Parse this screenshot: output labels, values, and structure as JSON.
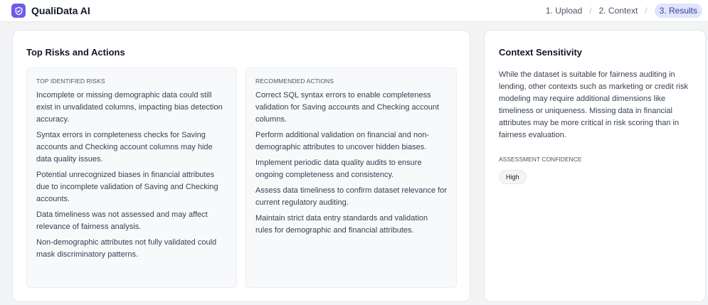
{
  "header": {
    "brand": "QualiData AI",
    "steps": [
      {
        "label": "1. Upload"
      },
      {
        "label": "2. Context"
      },
      {
        "label": "3. Results"
      }
    ],
    "separator": "/"
  },
  "main": {
    "title": "Top Risks and Actions",
    "risks": {
      "label": "TOP IDENTIFIED RISKS",
      "items": [
        "Incomplete or missing demographic data could still exist in unvalidated columns, impacting bias detection accuracy.",
        "Syntax errors in completeness checks for Saving accounts and Checking account columns may hide data quality issues.",
        "Potential unrecognized biases in financial attributes due to incomplete validation of Saving and Checking accounts.",
        "Data timeliness was not assessed and may affect relevance of fairness analysis.",
        "Non-demographic attributes not fully validated could mask discriminatory patterns."
      ]
    },
    "actions": {
      "label": "RECOMMENDED ACTIONS",
      "items": [
        "Correct SQL syntax errors to enable completeness validation for Saving accounts and Checking account columns.",
        "Perform additional validation on financial and non-demographic attributes to uncover hidden biases.",
        "Implement periodic data quality audits to ensure ongoing completeness and consistency.",
        "Assess data timeliness to confirm dataset relevance for current regulatory auditing.",
        "Maintain strict data entry standards and validation rules for demographic and financial attributes."
      ]
    }
  },
  "side": {
    "title": "Context Sensitivity",
    "text": "While the dataset is suitable for fairness auditing in lending, other contexts such as marketing or credit risk modeling may require additional dimensions like timeliness or uniqueness. Missing data in financial attributes may be more critical in risk scoring than in fairness evaluation.",
    "confidence_label": "ASSESSMENT CONFIDENCE",
    "confidence_value": "High"
  },
  "colors": {
    "accent": "#6d5be8",
    "active_step_bg": "#dfe4ff"
  },
  "icons": {
    "logo": "shield-icon"
  }
}
